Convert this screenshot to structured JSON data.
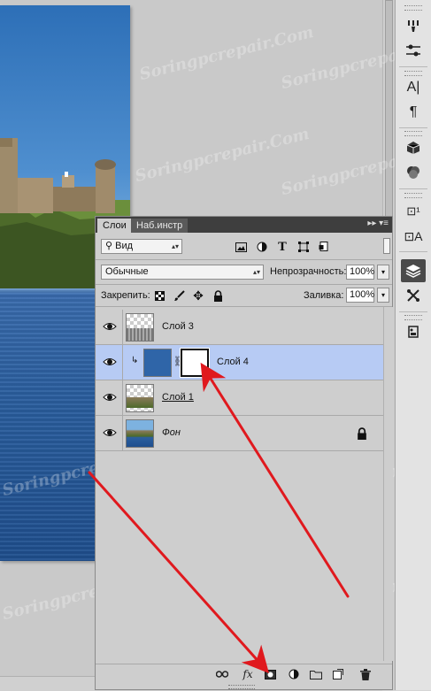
{
  "panel": {
    "tabs": [
      "Слои",
      "Наб.инстр"
    ],
    "filter_label": "Вид",
    "blend_mode": "Обычные",
    "opacity_label": "Непрозрачность:",
    "opacity_value": "100%",
    "lock_label": "Закрепить:",
    "fill_label": "Заливка:",
    "fill_value": "100%"
  },
  "layers": [
    {
      "name": "Слой 3",
      "visible": true,
      "selected": false
    },
    {
      "name": "Слой 4",
      "visible": true,
      "selected": true,
      "has_mask": true,
      "clipped": true
    },
    {
      "name": "Слой 1",
      "visible": true,
      "selected": false
    },
    {
      "name": "Фон",
      "visible": true,
      "selected": false,
      "locked": true
    }
  ],
  "watermark_text": "Soringpcrepair.Com",
  "colors": {
    "selected_row": "#b7cbf4",
    "arrow": "#e0191e",
    "panel_bg": "#cecece",
    "header_bg": "#3e3e3e"
  },
  "toolbar_icons": [
    "brush-settings-icon",
    "adjust-icon",
    "character-icon",
    "paragraph-icon",
    "3d-icon",
    "channels-icon",
    "clone-source-icon",
    "styles-icon",
    "layers-icon",
    "paths-icon",
    "properties-icon"
  ]
}
